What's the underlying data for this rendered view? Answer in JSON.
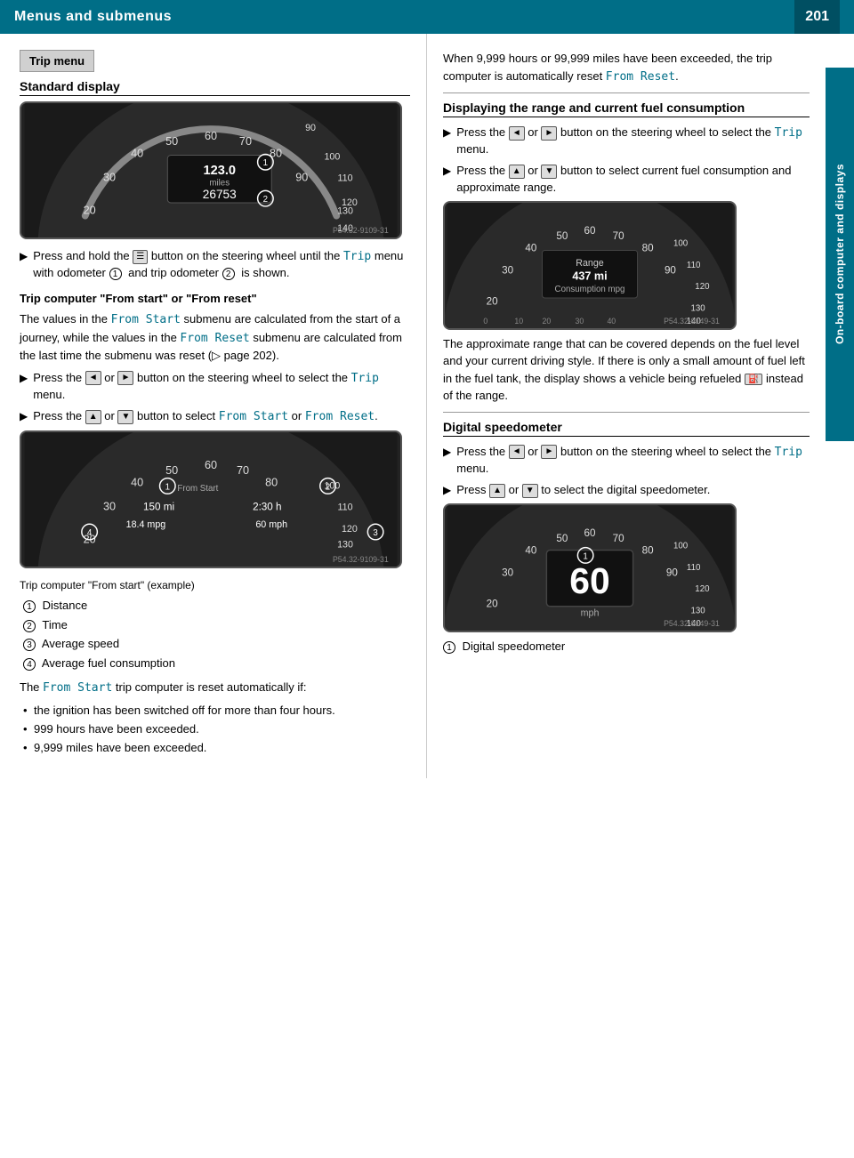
{
  "header": {
    "title": "Menus and submenus",
    "page_number": "201"
  },
  "side_tab": {
    "label": "On-board computer and displays"
  },
  "left_column": {
    "section_box": "Trip menu",
    "standard_display_title": "Standard display",
    "speedo1_caption": "P54.32-9109-31",
    "press_hold_text": "Press and hold the",
    "press_hold_text2": "button on the steering wheel until the",
    "press_hold_code": "Trip",
    "press_hold_text3": "menu with odometer",
    "press_hold_num1": "1",
    "press_hold_text4": "and trip odometer",
    "press_hold_num2": "2",
    "press_hold_text5": "is shown.",
    "trip_computer_title": "Trip computer \"From start\" or \"From reset\"",
    "trip_values_text": "The values in the",
    "trip_from_start_code": "From Start",
    "trip_values_text2": "submenu are calculated from the start of a journey, while the values in the",
    "trip_from_reset_code": "From Reset",
    "trip_values_text3": "submenu are calculated from the last time the submenu was reset (▷ page 202).",
    "arrow1_text": "Press the",
    "arrow1_btn1": "◄",
    "arrow1_or": "or",
    "arrow1_btn2": "►",
    "arrow1_text2": "button on the steering wheel to select the",
    "arrow1_code": "Trip",
    "arrow1_text3": "menu.",
    "arrow2_text": "Press the",
    "arrow2_btn1": "▲",
    "arrow2_or": "or",
    "arrow2_btn2": "▼",
    "arrow2_text2": "button to select",
    "arrow2_code1": "From Start",
    "arrow2_or2": "or",
    "arrow2_code2": "From Reset",
    "arrow2_end": ".",
    "speedo2_caption": "P54.32-9109-31",
    "trip_computer_caption": "Trip computer \"From start\" (example)",
    "legend_items": [
      {
        "num": "1",
        "label": "Distance"
      },
      {
        "num": "2",
        "label": "Time"
      },
      {
        "num": "3",
        "label": "Average speed"
      },
      {
        "num": "4",
        "label": "Average fuel consumption"
      }
    ],
    "from_start_text": "The",
    "from_start_code": "From Start",
    "from_start_text2": "trip computer is reset automatically if:",
    "bullet_items": [
      "the ignition has been switched off for more than four hours.",
      "999 hours have been exceeded.",
      "9,999 miles have been exceeded."
    ]
  },
  "right_column": {
    "intro_text": "When 9,999 hours or 99,999 miles have been exceeded, the trip computer is automatically reset",
    "intro_code": "From Reset",
    "intro_end": ".",
    "fuel_section_title": "Displaying the range and current fuel consumption",
    "fuel_arrow1_text": "Press the",
    "fuel_arrow1_btn1": "◄",
    "fuel_arrow1_or": "or",
    "fuel_arrow1_btn2": "►",
    "fuel_arrow1_text2": "button on the steering wheel to select the",
    "fuel_arrow1_code": "Trip",
    "fuel_arrow1_text3": "menu.",
    "fuel_arrow2_text": "Press the",
    "fuel_arrow2_btn1": "▲",
    "fuel_arrow2_or": "or",
    "fuel_arrow2_btn2": "▼",
    "fuel_arrow2_text2": "button to select current fuel consumption and approximate range.",
    "fuel_speedo_caption": "P54.32-9149-31",
    "fuel_approx_text": "The approximate range that can be covered depends on the fuel level and your current driving style. If there is only a small amount of fuel left in the fuel tank, the display shows a vehicle being refueled",
    "fuel_approx_text2": "instead of the range.",
    "digital_speedo_title": "Digital speedometer",
    "digital_arrow1_text": "Press the",
    "digital_arrow1_btn1": "◄",
    "digital_arrow1_or": "or",
    "digital_arrow1_btn2": "►",
    "digital_arrow1_text2": "button on the steering wheel to select the",
    "digital_arrow1_code": "Trip",
    "digital_arrow1_text3": "menu.",
    "digital_arrow2_text": "Press",
    "digital_arrow2_btn1": "▲",
    "digital_arrow2_or": "or",
    "digital_arrow2_btn2": "▼",
    "digital_arrow2_text2": "to select the digital speedometer.",
    "digital_speedo_caption": "P54.32-9149-31",
    "digital_legend_num": "1",
    "digital_legend_label": "Digital speedometer"
  }
}
